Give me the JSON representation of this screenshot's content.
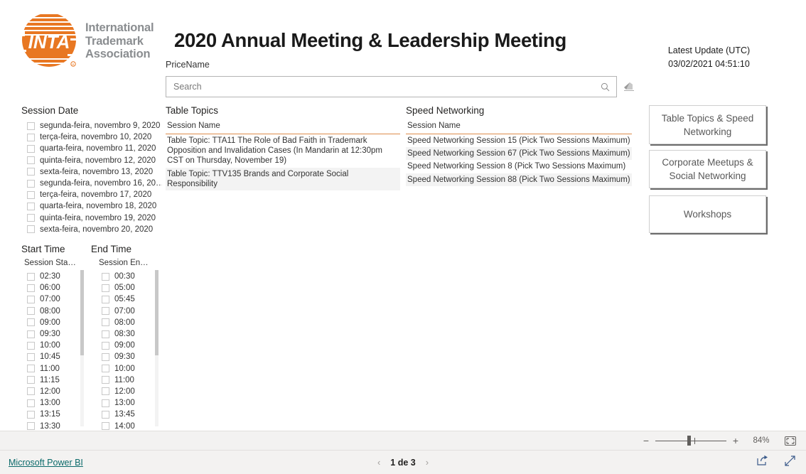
{
  "logo": {
    "mark_text": "INTA",
    "words": [
      "International",
      "Trademark",
      "Association"
    ],
    "color": "#E87722",
    "words_color": "#8a8d90"
  },
  "header": {
    "title": "2020 Annual Meeting & Leadership Meeting",
    "pricename_label": "PriceName",
    "search_placeholder": "Search",
    "search_value": "",
    "search_icon": "search-icon",
    "eraser_icon": "eraser-icon"
  },
  "latest_update": {
    "title": "Latest Update (UTC)",
    "value": "03/02/2021 04:51:10"
  },
  "session_date": {
    "heading": "Session Date",
    "items": [
      "segunda-feira, novembro 9, 2020",
      "terça-feira, novembro 10, 2020",
      "quarta-feira, novembro 11, 2020",
      "quinta-feira, novembro 12, 2020",
      "sexta-feira, novembro 13, 2020",
      "segunda-feira, novembro 16, 20…",
      "terça-feira, novembro 17, 2020",
      "quarta-feira, novembro 18, 2020",
      "quinta-feira, novembro 19, 2020",
      "sexta-feira, novembro 20, 2020"
    ]
  },
  "start_time": {
    "heading": "Start Time",
    "subheader": "Session Sta…",
    "items": [
      "02:30",
      "06:00",
      "07:00",
      "08:00",
      "09:00",
      "09:30",
      "10:00",
      "10:45",
      "11:00",
      "11:15",
      "12:00",
      "13:00",
      "13:15",
      "13:30"
    ]
  },
  "end_time": {
    "heading": "End Time",
    "subheader": "Session En…",
    "items": [
      "00:30",
      "05:00",
      "05:45",
      "07:00",
      "08:00",
      "08:30",
      "09:00",
      "09:30",
      "10:00",
      "11:00",
      "12:00",
      "13:00",
      "13:45",
      "14:00"
    ]
  },
  "table_topics": {
    "heading": "Table Topics",
    "column_header": "Session Name",
    "accent_color": "#DE8B4B",
    "rows": [
      "Table Topic: TTA11 The Role of Bad Faith in Trademark Opposition and Invalidation Cases (In Mandarin at 12:30pm CST on Thursday, November 19)",
      "Table Topic: TTV135 Brands and Corporate Social Responsibility"
    ]
  },
  "speed_networking": {
    "heading": "Speed Networking",
    "column_header": "Session Name",
    "accent_color": "#DE8B4B",
    "rows": [
      "Speed Networking Session 15 (Pick Two Sessions Maximum)",
      "Speed Networking Session 67 (Pick Two Sessions Maximum)",
      "Speed Networking Session 8 (Pick Two Sessions Maximum)",
      "Speed Networking Session 88 (Pick Two Sessions Maximum)"
    ]
  },
  "nav_buttons": [
    "Table Topics & Speed Networking",
    "Corporate Meetups & Social Networking",
    "Workshops"
  ],
  "toolbar": {
    "zoom_minus": "−",
    "zoom_plus": "+",
    "zoom_percent": "84%",
    "fit_icon": "fit-to-page-icon"
  },
  "footer": {
    "powerbi_label": "Microsoft Power BI",
    "prev_arrow": "‹",
    "next_arrow": "›",
    "page_label": "1 de 3",
    "share_icon": "share-icon",
    "fullscreen_icon": "fullscreen-icon"
  }
}
